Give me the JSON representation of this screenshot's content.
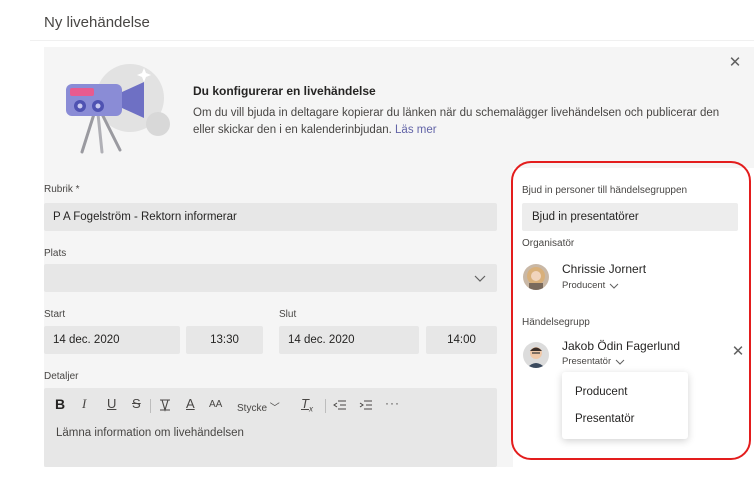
{
  "page": {
    "title": "Ny livehändelse"
  },
  "banner": {
    "heading": "Du konfigurerar en livehändelse",
    "text": "Om du vill bjuda in deltagare kopierar du länken när du schemalägger livehändelsen och publicerar den eller skickar den i en kalenderinbjudan.",
    "link": "Läs mer",
    "close_icon": "close-icon"
  },
  "form": {
    "title_label": "Rubrik *",
    "title_value": "P A Fogelström - Rektorn informerar",
    "location_label": "Plats",
    "location_value": "",
    "start_label": "Start",
    "start_date": "14 dec. 2020",
    "start_time": "13:30",
    "end_label": "Slut",
    "end_date": "14 dec. 2020",
    "end_time": "14:00",
    "details_label": "Detaljer",
    "details_placeholder": "Lämna information om livehändelsen",
    "toolbar": {
      "bold": "B",
      "italic": "I",
      "underline": "U",
      "strike": "S",
      "font_color": "A",
      "font_size": "AA",
      "style": "Stycke",
      "clear_format": "T",
      "clear_sub": "x",
      "more": "···"
    }
  },
  "panel": {
    "invite_label": "Bjud in personer till händelsegruppen",
    "invite_placeholder": "Bjud in presentatörer",
    "organizer_label": "Organisatör",
    "organizer": {
      "name": "Chrissie Jornert",
      "role": "Producent"
    },
    "group_label": "Händelsegrupp",
    "member": {
      "name": "Jakob Ödin Fagerlund",
      "role": "Presentatör"
    },
    "role_menu": [
      "Producent",
      "Presentatör"
    ]
  },
  "colors": {
    "accent": "#6264a7",
    "highlight": "#e31d1d"
  }
}
